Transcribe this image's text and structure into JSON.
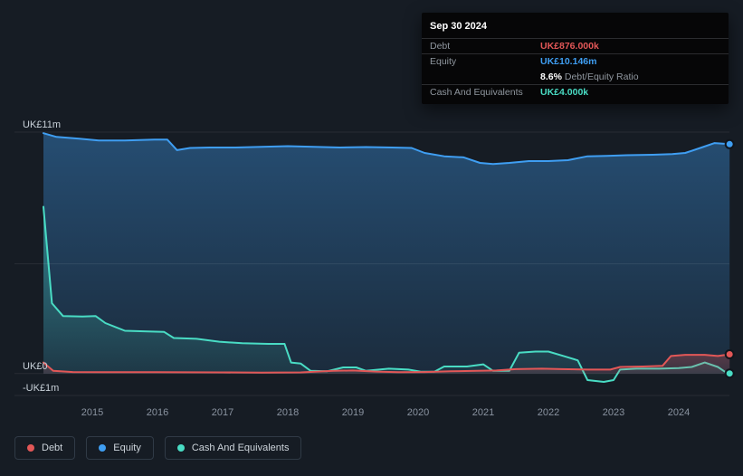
{
  "tooltip": {
    "date": "Sep 30 2024",
    "debt_label": "Debt",
    "debt_value": "UK£876.000k",
    "equity_label": "Equity",
    "equity_value": "UK£10.146m",
    "ratio_value": "8.6%",
    "ratio_text": "Debt/Equity Ratio",
    "cash_label": "Cash And Equivalents",
    "cash_value": "UK£4.000k"
  },
  "legend": {
    "items": [
      {
        "label": "Debt",
        "color": "#e25757"
      },
      {
        "label": "Equity",
        "color": "#3f9ef2"
      },
      {
        "label": "Cash And Equivalents",
        "color": "#49dcc4"
      }
    ]
  },
  "colors": {
    "background": "#161c24",
    "tooltip_bg": "#060607",
    "debt": "#e25757",
    "equity": "#3f9ef2",
    "cash": "#49dcc4"
  },
  "chart_data": {
    "type": "area",
    "x_ticks": [
      2015,
      2016,
      2017,
      2018,
      2019,
      2020,
      2021,
      2022,
      2023,
      2024
    ],
    "x_range": [
      2014.25,
      2024.78
    ],
    "ylim": [
      -1,
      11
    ],
    "y_gridlines": [
      11,
      5,
      0,
      -1
    ],
    "y_labels": [
      {
        "value": 11,
        "text": "UK£11m"
      },
      {
        "value": 0,
        "text": "UK£0"
      },
      {
        "value": -1,
        "text": "-UK£1m"
      }
    ],
    "grid": true,
    "legend_position": "bottom-left",
    "series": [
      {
        "name": "Equity",
        "color": "#3f9ef2",
        "fill": true,
        "fill_opacity_top": 0.38,
        "fill_opacity_bottom": 0.12,
        "points": [
          [
            2014.25,
            10.95
          ],
          [
            2014.45,
            10.78
          ],
          [
            2014.8,
            10.7
          ],
          [
            2015.1,
            10.62
          ],
          [
            2015.5,
            10.62
          ],
          [
            2015.95,
            10.66
          ],
          [
            2016.15,
            10.66
          ],
          [
            2016.3,
            10.18
          ],
          [
            2016.5,
            10.28
          ],
          [
            2016.8,
            10.3
          ],
          [
            2017.2,
            10.3
          ],
          [
            2017.6,
            10.33
          ],
          [
            2018.0,
            10.36
          ],
          [
            2018.4,
            10.33
          ],
          [
            2018.8,
            10.3
          ],
          [
            2019.2,
            10.32
          ],
          [
            2019.6,
            10.3
          ],
          [
            2019.9,
            10.28
          ],
          [
            2020.1,
            10.05
          ],
          [
            2020.4,
            9.9
          ],
          [
            2020.7,
            9.85
          ],
          [
            2020.95,
            9.6
          ],
          [
            2021.15,
            9.55
          ],
          [
            2021.4,
            9.6
          ],
          [
            2021.7,
            9.68
          ],
          [
            2022.0,
            9.68
          ],
          [
            2022.3,
            9.72
          ],
          [
            2022.6,
            9.9
          ],
          [
            2022.9,
            9.92
          ],
          [
            2023.2,
            9.95
          ],
          [
            2023.6,
            9.97
          ],
          [
            2023.9,
            10.0
          ],
          [
            2024.1,
            10.05
          ],
          [
            2024.35,
            10.3
          ],
          [
            2024.55,
            10.5
          ],
          [
            2024.78,
            10.45
          ]
        ]
      },
      {
        "name": "Cash And Equivalents",
        "color": "#49dcc4",
        "fill": true,
        "fill_opacity_top": 0.4,
        "fill_opacity_bottom": 0.05,
        "points": [
          [
            2014.25,
            7.6
          ],
          [
            2014.38,
            3.2
          ],
          [
            2014.55,
            2.62
          ],
          [
            2014.85,
            2.6
          ],
          [
            2015.05,
            2.62
          ],
          [
            2015.2,
            2.3
          ],
          [
            2015.5,
            1.95
          ],
          [
            2015.85,
            1.92
          ],
          [
            2016.1,
            1.9
          ],
          [
            2016.25,
            1.62
          ],
          [
            2016.6,
            1.58
          ],
          [
            2016.95,
            1.45
          ],
          [
            2017.3,
            1.38
          ],
          [
            2017.7,
            1.35
          ],
          [
            2017.95,
            1.35
          ],
          [
            2018.05,
            0.5
          ],
          [
            2018.2,
            0.45
          ],
          [
            2018.35,
            0.12
          ],
          [
            2018.6,
            0.1
          ],
          [
            2018.85,
            0.28
          ],
          [
            2019.05,
            0.28
          ],
          [
            2019.2,
            0.12
          ],
          [
            2019.55,
            0.22
          ],
          [
            2019.85,
            0.18
          ],
          [
            2020.05,
            0.08
          ],
          [
            2020.25,
            0.08
          ],
          [
            2020.4,
            0.32
          ],
          [
            2020.75,
            0.32
          ],
          [
            2021.0,
            0.42
          ],
          [
            2021.15,
            0.12
          ],
          [
            2021.4,
            0.12
          ],
          [
            2021.55,
            0.95
          ],
          [
            2021.8,
            1.0
          ],
          [
            2022.0,
            1.0
          ],
          [
            2022.25,
            0.78
          ],
          [
            2022.45,
            0.6
          ],
          [
            2022.6,
            -0.3
          ],
          [
            2022.85,
            -0.38
          ],
          [
            2023.0,
            -0.3
          ],
          [
            2023.1,
            0.18
          ],
          [
            2023.35,
            0.22
          ],
          [
            2023.7,
            0.22
          ],
          [
            2024.0,
            0.25
          ],
          [
            2024.2,
            0.3
          ],
          [
            2024.4,
            0.5
          ],
          [
            2024.6,
            0.3
          ],
          [
            2024.72,
            0.06
          ],
          [
            2024.78,
            0.004
          ]
        ]
      },
      {
        "name": "Debt",
        "color": "#e25757",
        "fill": true,
        "fill_opacity_top": 0.3,
        "fill_opacity_bottom": 0.15,
        "points": [
          [
            2014.25,
            0.5
          ],
          [
            2014.4,
            0.12
          ],
          [
            2014.7,
            0.07
          ],
          [
            2015.2,
            0.06
          ],
          [
            2016.0,
            0.06
          ],
          [
            2017.0,
            0.05
          ],
          [
            2017.6,
            0.04
          ],
          [
            2018.2,
            0.05
          ],
          [
            2018.7,
            0.12
          ],
          [
            2019.0,
            0.14
          ],
          [
            2019.35,
            0.09
          ],
          [
            2019.7,
            0.06
          ],
          [
            2020.1,
            0.07
          ],
          [
            2020.5,
            0.1
          ],
          [
            2020.9,
            0.12
          ],
          [
            2021.2,
            0.14
          ],
          [
            2021.5,
            0.2
          ],
          [
            2021.9,
            0.22
          ],
          [
            2022.2,
            0.2
          ],
          [
            2022.6,
            0.18
          ],
          [
            2022.95,
            0.18
          ],
          [
            2023.1,
            0.3
          ],
          [
            2023.45,
            0.32
          ],
          [
            2023.75,
            0.35
          ],
          [
            2023.88,
            0.8
          ],
          [
            2024.1,
            0.85
          ],
          [
            2024.4,
            0.85
          ],
          [
            2024.6,
            0.8
          ],
          [
            2024.78,
            0.876
          ]
        ]
      }
    ]
  }
}
